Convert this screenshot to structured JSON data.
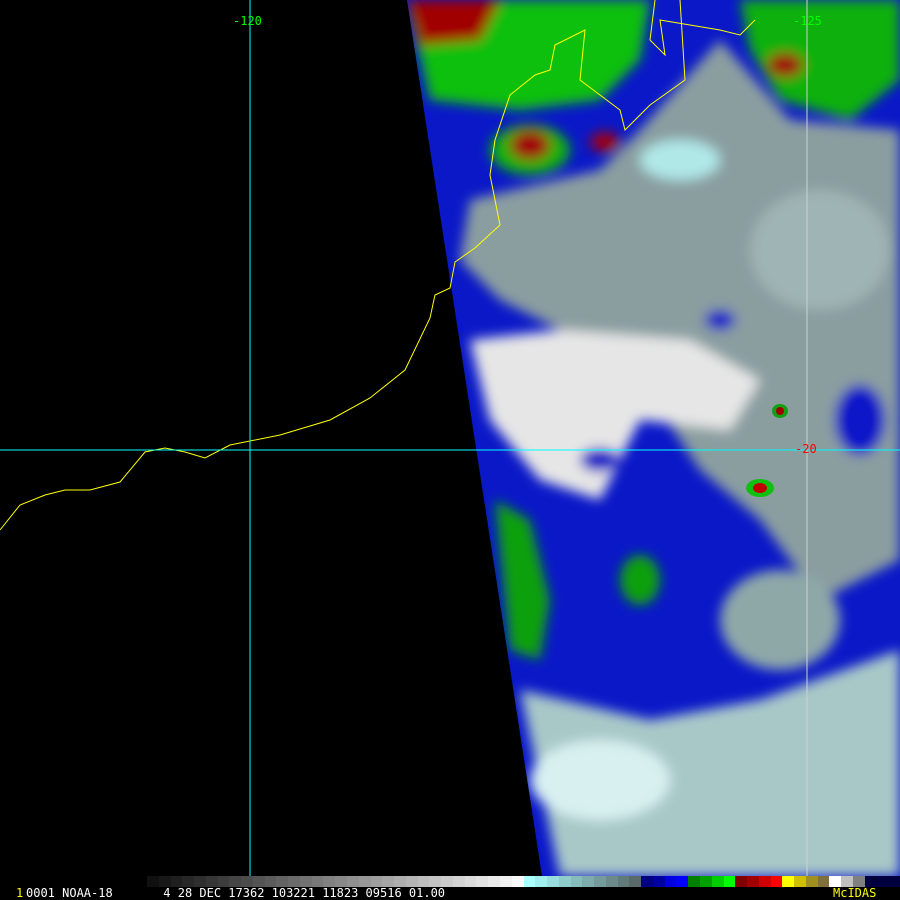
{
  "grid_labels": {
    "lon_left": "-120",
    "lon_right": "-125",
    "lat": "-20"
  },
  "footer": {
    "frame_marker": "1",
    "info": "0001 NOAA-18       4 28 DEC 17362 103221 11823 09516 01.00",
    "brand": "McIDAS"
  },
  "colors": {
    "grid": "#00ffff",
    "coast": "#ffff00",
    "lon_label": "#00ff00",
    "lat_label": "#ff0000",
    "brand": "#ffff00"
  }
}
